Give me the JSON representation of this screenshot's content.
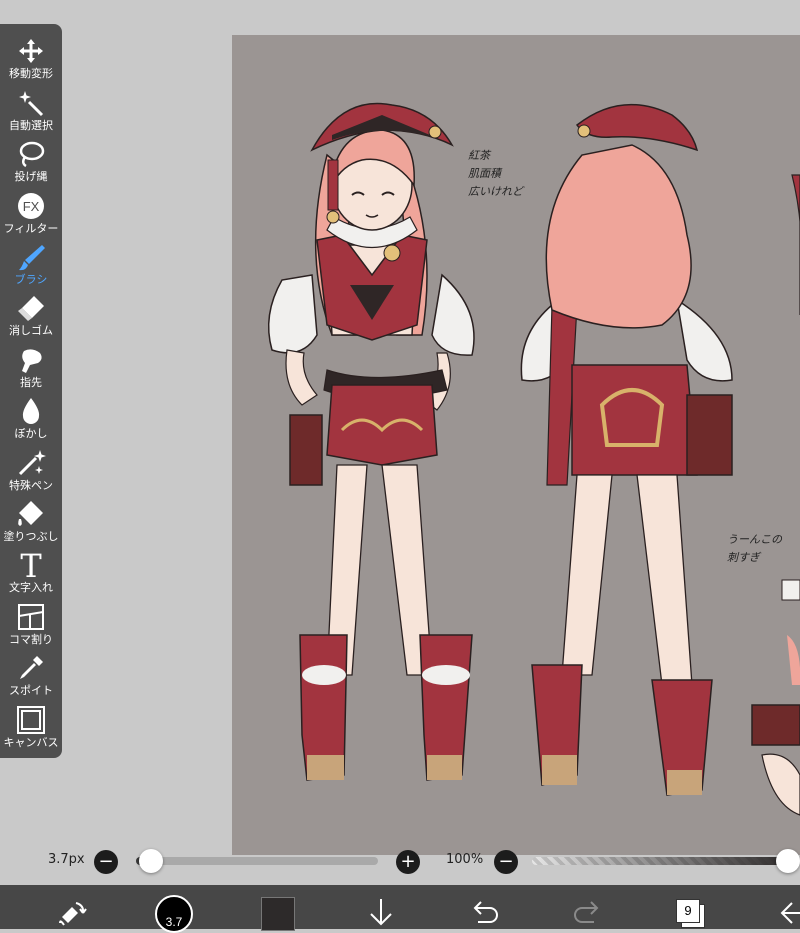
{
  "tools": [
    {
      "label": "移動変形",
      "icon": "move-icon"
    },
    {
      "label": "自動選択",
      "icon": "magic-wand-icon"
    },
    {
      "label": "投げ縄",
      "icon": "lasso-icon"
    },
    {
      "label": "フィルター",
      "icon": "fx-icon",
      "icon_text": "FX"
    },
    {
      "label": "ブラシ",
      "icon": "brush-icon",
      "active": true
    },
    {
      "label": "消しゴム",
      "icon": "eraser-icon"
    },
    {
      "label": "指先",
      "icon": "finger-icon"
    },
    {
      "label": "ぼかし",
      "icon": "blur-icon"
    },
    {
      "label": "特殊ペン",
      "icon": "special-pen-icon"
    },
    {
      "label": "塗りつぶし",
      "icon": "fill-icon"
    },
    {
      "label": "文字入れ",
      "icon": "text-icon",
      "icon_text": "T"
    },
    {
      "label": "コマ割り",
      "icon": "frame-divider-icon"
    },
    {
      "label": "スポイト",
      "icon": "eyedropper-icon"
    },
    {
      "label": "キャンバス",
      "icon": "canvas-icon"
    }
  ],
  "brush_size": {
    "value": "3.7px",
    "minus": "−",
    "plus": "+",
    "level": 0.03
  },
  "opacity": {
    "value": "100%",
    "minus": "−",
    "level": 1.0
  },
  "bottom": {
    "brush_preview_label": "3.7",
    "layer_count": "9",
    "color": "#2d2a2a"
  },
  "notes": {
    "top": "紅茶\n肌面積\n広いけれど",
    "bottom": "うーんこの\n刺すぎ"
  },
  "colors": {
    "accent": "#4fa6ff",
    "toolbar_bg": "#4f4f4f",
    "canvas_bg": "#9b9593",
    "outfit_red": "#a2343f",
    "hair_pink": "#efa59a"
  }
}
